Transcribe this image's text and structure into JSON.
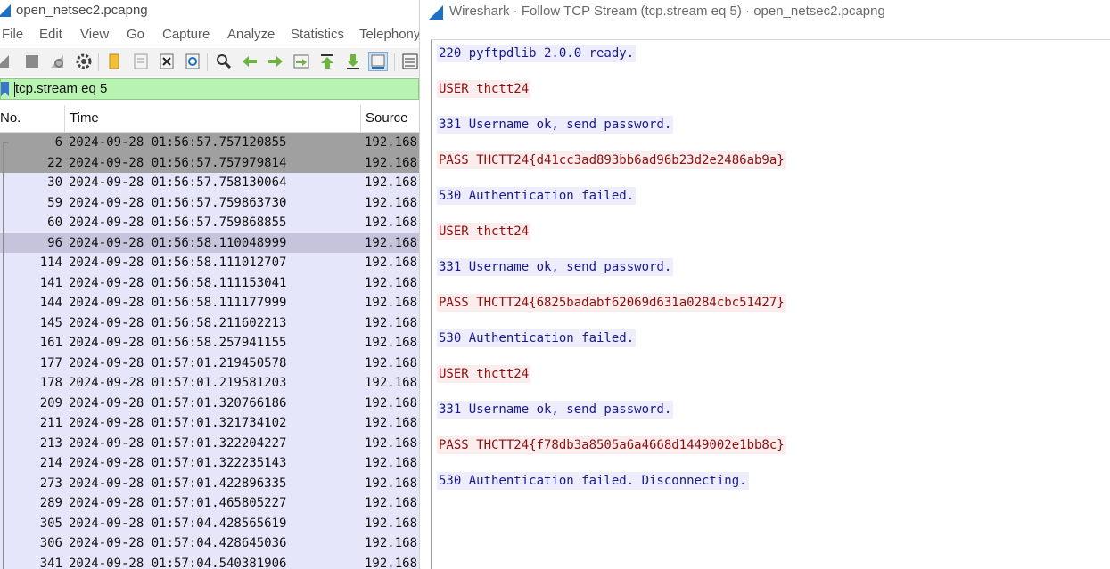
{
  "main_window": {
    "title": "open_netsec2.pcapng",
    "menu": [
      "File",
      "Edit",
      "View",
      "Go",
      "Capture",
      "Analyze",
      "Statistics",
      "Telephony"
    ],
    "toolbar_icons": [
      "shark-fin-start-icon",
      "stop-icon",
      "restart-icon",
      "options-gear-icon",
      "open-folder-icon",
      "save-file-icon",
      "close-file-icon",
      "reload-icon",
      "find-icon",
      "back-arrow-icon",
      "forward-arrow-icon",
      "go-to-packet-icon",
      "first-packet-icon",
      "last-packet-icon",
      "autoscroll-icon",
      "colorize-icon"
    ],
    "filter": {
      "value": "tcp.stream eq 5"
    },
    "columns": {
      "no": "No.",
      "time": "Time",
      "source": "Source"
    },
    "packets": [
      {
        "no": "6",
        "time": "2024-09-28 01:56:57.757120855",
        "src": "192.168"
      },
      {
        "no": "22",
        "time": "2024-09-28 01:56:57.757979814",
        "src": "192.168"
      },
      {
        "no": "30",
        "time": "2024-09-28 01:56:57.758130064",
        "src": "192.168"
      },
      {
        "no": "59",
        "time": "2024-09-28 01:56:57.759863730",
        "src": "192.168"
      },
      {
        "no": "60",
        "time": "2024-09-28 01:56:57.759868855",
        "src": "192.168"
      },
      {
        "no": "96",
        "time": "2024-09-28 01:56:58.110048999",
        "src": "192.168"
      },
      {
        "no": "114",
        "time": "2024-09-28 01:56:58.111012707",
        "src": "192.168"
      },
      {
        "no": "141",
        "time": "2024-09-28 01:56:58.111153041",
        "src": "192.168"
      },
      {
        "no": "144",
        "time": "2024-09-28 01:56:58.111177999",
        "src": "192.168"
      },
      {
        "no": "145",
        "time": "2024-09-28 01:56:58.211602213",
        "src": "192.168"
      },
      {
        "no": "161",
        "time": "2024-09-28 01:56:58.257941155",
        "src": "192.168"
      },
      {
        "no": "177",
        "time": "2024-09-28 01:57:01.219450578",
        "src": "192.168"
      },
      {
        "no": "178",
        "time": "2024-09-28 01:57:01.219581203",
        "src": "192.168"
      },
      {
        "no": "209",
        "time": "2024-09-28 01:57:01.320766186",
        "src": "192.168"
      },
      {
        "no": "211",
        "time": "2024-09-28 01:57:01.321734102",
        "src": "192.168"
      },
      {
        "no": "213",
        "time": "2024-09-28 01:57:01.322204227",
        "src": "192.168"
      },
      {
        "no": "214",
        "time": "2024-09-28 01:57:01.322235143",
        "src": "192.168"
      },
      {
        "no": "273",
        "time": "2024-09-28 01:57:01.422896335",
        "src": "192.168"
      },
      {
        "no": "289",
        "time": "2024-09-28 01:57:01.465805227",
        "src": "192.168"
      },
      {
        "no": "305",
        "time": "2024-09-28 01:57:04.428565619",
        "src": "192.168"
      },
      {
        "no": "306",
        "time": "2024-09-28 01:57:04.428645036",
        "src": "192.168"
      },
      {
        "no": "341",
        "time": "2024-09-28 01:57:04.540381906",
        "src": "192.168"
      }
    ],
    "colors": {
      "filter_valid_bg": "#b9f3b2",
      "row_default_bg": "#e6e6fa",
      "row_selected_dark_bg": "#a0a0a0",
      "row_selected_mid_bg": "#c6c4dc"
    }
  },
  "follow_window": {
    "title": "Wireshark · Follow TCP Stream (tcp.stream eq 5) · open_netsec2.pcapng",
    "lines": [
      {
        "dir": "server",
        "text": "220 pyftpdlib 2.0.0 ready."
      },
      {
        "dir": "client",
        "text": "USER thctt24"
      },
      {
        "dir": "server",
        "text": "331 Username ok, send password."
      },
      {
        "dir": "client",
        "text": "PASS THCTT24{d41cc3ad893bb6ad96b23d2e2486ab9a}"
      },
      {
        "dir": "server",
        "text": "530 Authentication failed."
      },
      {
        "dir": "client",
        "text": "USER thctt24"
      },
      {
        "dir": "server",
        "text": "331 Username ok, send password."
      },
      {
        "dir": "client",
        "text": "PASS THCTT24{6825badabf62069d631a0284cbc51427}"
      },
      {
        "dir": "server",
        "text": "530 Authentication failed."
      },
      {
        "dir": "client",
        "text": "USER thctt24"
      },
      {
        "dir": "server",
        "text": "331 Username ok, send password."
      },
      {
        "dir": "client",
        "text": "PASS THCTT24{f78db3a8505a6a4668d1449002e1bb8c}"
      },
      {
        "dir": "server",
        "text": "530 Authentication failed. Disconnecting."
      }
    ],
    "colors": {
      "server_text": "#1a1a8c",
      "server_bg": "#ededfb",
      "client_text": "#8c1010",
      "client_bg": "#fbeded"
    }
  }
}
